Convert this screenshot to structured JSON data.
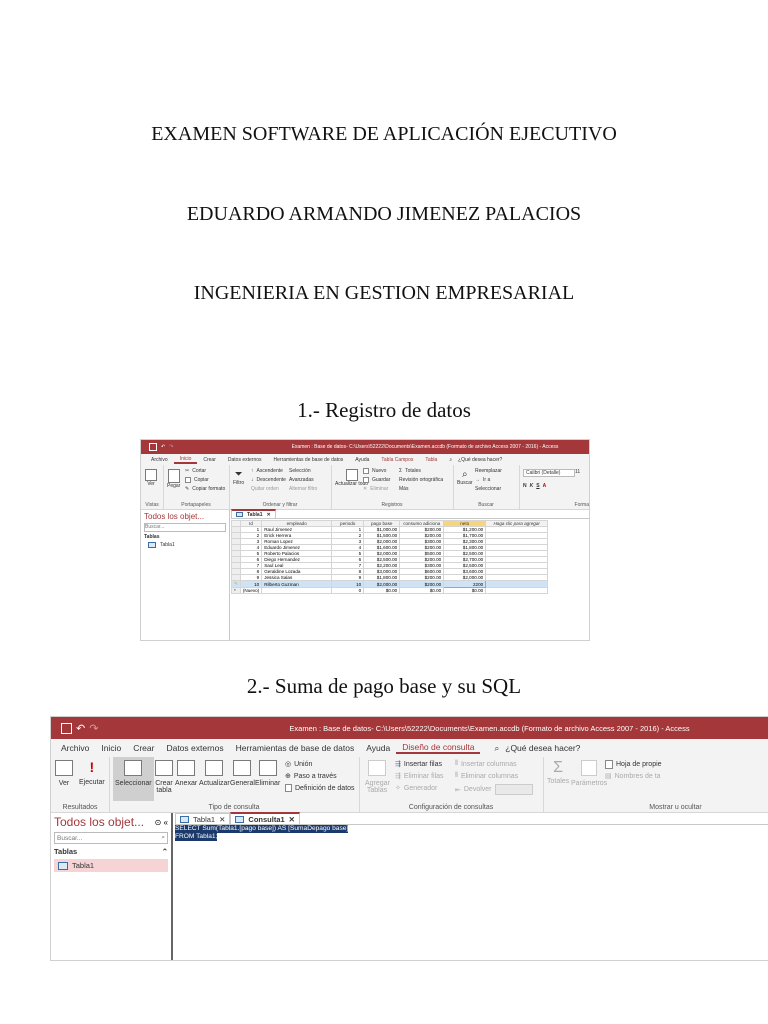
{
  "doc": {
    "title": "EXAMEN SOFTWARE DE APLICACIÓN EJECUTIVO",
    "author": "EDUARDO ARMANDO JIMENEZ PALACIOS",
    "program": "INGENIERIA EN GESTION EMPRESARIAL",
    "section1": "1.- Registro de datos",
    "section2": "2.- Suma de pago base y su SQL"
  },
  "colors": {
    "accent": "#a4373a",
    "selection": "#cfe3f7",
    "sql_highlight": "#1b3a6b"
  },
  "shot1": {
    "window_title": "Examen : Base de datos- C:\\Users\\52222\\Documents\\Examen.accdb (Formato de archivo Access 2007 - 2016) - Access",
    "menu": [
      "Archivo",
      "Inicio",
      "Crear",
      "Datos externos",
      "Herramientas de base de datos",
      "Ayuda",
      "Tabla Campos",
      "Tabla"
    ],
    "tell_me": "¿Qué desea hacer?",
    "groups": {
      "vistas": {
        "label": "Vistas",
        "ver": "Ver"
      },
      "portapapeles": {
        "label": "Portapapeles",
        "pegar": "Pegar",
        "cortar": "Cortar",
        "copiar": "Copiar",
        "copiar_formato": "Copiar formato"
      },
      "ordenar": {
        "label": "Ordenar y filtrar",
        "filtro": "Filtro",
        "ascendente": "Ascendente",
        "descendente": "Descendente",
        "quitar_orden": "Quitar orden",
        "seleccion": "Selección",
        "avanzadas": "Avanzadas",
        "alternar_filtro": "Alternar filtro"
      },
      "registros": {
        "label": "Registros",
        "actualizar": "Actualizar todo",
        "nuevo": "Nuevo",
        "guardar": "Guardar",
        "eliminar": "Eliminar",
        "totales": "Totales",
        "ortografia": "Revisión ortográfica",
        "mas": "Más"
      },
      "buscar": {
        "label": "Buscar",
        "buscar": "Buscar",
        "reemplazar": "Reemplazar",
        "ir_a": "Ir a",
        "seleccionar": "Seleccionar"
      },
      "formato": {
        "label": "Forma",
        "font": "Calibri (Detalle)",
        "size": "11"
      }
    },
    "nav": {
      "title": "Todos los objet...",
      "search_placeholder": "Buscar...",
      "section": "Tablas",
      "items": [
        "Tabla1"
      ]
    },
    "tab": "Tabla1",
    "columns": [
      "Id",
      "empleado",
      "periodo",
      "pago base",
      "consumo adiciona",
      "neto",
      "Haga clic para agregar"
    ],
    "rows": [
      [
        "1",
        "Raul Jimenez",
        "1",
        "$1,000.00",
        "$200.00",
        "$1,200.00"
      ],
      [
        "2",
        "Erick Herrera",
        "2",
        "$1,500.00",
        "$200.00",
        "$1,700.00"
      ],
      [
        "3",
        "Roman Lopez",
        "3",
        "$2,000.00",
        "$300.00",
        "$2,300.00"
      ],
      [
        "4",
        "Eduardo Jimenez",
        "4",
        "$1,600.00",
        "$200.00",
        "$1,800.00"
      ],
      [
        "5",
        "Roberto Palacios",
        "5",
        "$2,000.00",
        "$500.00",
        "$2,500.00"
      ],
      [
        "6",
        "Diego Hernandez",
        "6",
        "$2,500.00",
        "$200.00",
        "$2,700.00"
      ],
      [
        "7",
        "Saul Leal",
        "7",
        "$2,200.00",
        "$300.00",
        "$2,500.00"
      ],
      [
        "8",
        "Geraldine Lozada",
        "8",
        "$3,000.00",
        "$600.00",
        "$3,600.00"
      ],
      [
        "9",
        "Jessica Salas",
        "9",
        "$1,800.00",
        "$200.00",
        "$2,000.00"
      ],
      [
        "10",
        "Rilberto Guzman",
        "10",
        "$2,000.00",
        "$200.00",
        "2200"
      ]
    ],
    "new_row": [
      "(Nuevo)",
      "0",
      "$0.00",
      "$0.00",
      "$0.00"
    ]
  },
  "shot2": {
    "window_title": "Examen : Base de datos- C:\\Users\\52222\\Documents\\Examen.accdb (Formato de archivo Access 2007 - 2016) - Access",
    "menu": [
      "Archivo",
      "Inicio",
      "Crear",
      "Datos externos",
      "Herramientas de base de datos",
      "Ayuda",
      "Diseño de consulta"
    ],
    "tell_me": "¿Qué desea hacer?",
    "groups": {
      "resultados": {
        "label": "Resultados",
        "ver": "Ver",
        "ejecutar": "Ejecutar"
      },
      "tipo": {
        "label": "Tipo de consulta",
        "seleccionar": "Seleccionar",
        "crear_tabla": "Crear tabla",
        "anexar": "Anexar",
        "actualizar": "Actualizar",
        "general": "General",
        "eliminar": "Eliminar",
        "union": "Unión",
        "paso_traves": "Paso a través",
        "definicion": "Definición de datos"
      },
      "config": {
        "label": "Configuración de consultas",
        "agregar_tablas": "Agregar Tablas",
        "insertar_filas": "Insertar filas",
        "eliminar_filas": "Eliminar filas",
        "generador": "Generador",
        "insertar_columnas": "Insertar columnas",
        "eliminar_columnas": "Eliminar columnas",
        "devolver": "Devolver"
      },
      "mostrar": {
        "label": "Mostrar u ocultar",
        "totales": "Totales",
        "parametros": "Parámetros",
        "hoja_prop": "Hoja de propie",
        "nombres_tabla": "Nombres de ta"
      }
    },
    "nav": {
      "title": "Todos los objet...",
      "search_placeholder": "Buscar...",
      "section": "Tablas",
      "items": [
        "Tabla1"
      ]
    },
    "tabs": [
      "Tabla1",
      "Consulta1"
    ],
    "sql_lines": [
      "SELECT Sum(Tabla1.[pago base]) AS [SumaDepago base]",
      "FROM Tabla1;"
    ]
  }
}
